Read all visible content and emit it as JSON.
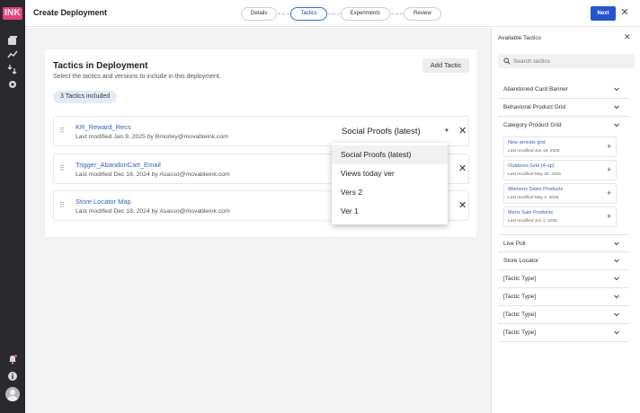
{
  "app": {
    "logo_text": "INK",
    "brand_color": "#e8407a",
    "accent_color": "#2454d6",
    "rail_icons": [
      "library-icon",
      "analytics-icon",
      "flows-icon",
      "settings-icon",
      "notification-bell-icon",
      "info-icon"
    ]
  },
  "header": {
    "title": "Create Deployment",
    "steps": [
      "Details",
      "Tactics",
      "Experiments",
      "Review"
    ],
    "active_step": "Tactics",
    "next_label": "Next",
    "close_label": "✕"
  },
  "main": {
    "card_title": "Tactics in Deployment",
    "card_subtitle": "Select the tactics and versions to include in this deployment.",
    "add_button": "Add Tactic",
    "count_badge": "3 Tactics included",
    "rows": [
      {
        "name": "KR_Reward_Recs",
        "meta": "Last modified Jan 9, 2025 by Bmorley@movableink.com",
        "version": "Social Proofs (latest)"
      },
      {
        "name": "Trigger_AbandonCart_Email",
        "meta": "Last modified Dec 18, 2024 by Asasso@movableink.com"
      },
      {
        "name": "Store Locator Map",
        "meta": "Last modified Dec 18, 2024 by Asasso@movableink.com"
      }
    ],
    "version_options": [
      "Social Proofs (latest)",
      "Views today ver",
      "Vers 2",
      "Ver 1"
    ]
  },
  "panel": {
    "title": "Available Tactics",
    "search_placeholder": "Search tactics",
    "categories": [
      {
        "label": "Abandoned Card Banner"
      },
      {
        "label": "Behavioral Product Grid"
      },
      {
        "label": "Category Product Grid",
        "expanded": true
      }
    ],
    "sub_items": [
      {
        "name": "New arrivals grid",
        "meta": "Last modified Jun 18, 2025"
      },
      {
        "name": "Outdoors Grid (4-up)",
        "meta": "Last modified May 20, 2025"
      },
      {
        "name": "Womens Sales Products",
        "meta": "Last modified May 2, 2025"
      },
      {
        "name": "Mens Sale Products",
        "meta": "Last modified Jun 1, 2025"
      }
    ],
    "more_categories": [
      "Live Poll",
      "Store Locator",
      "[Tactic Type]",
      "[Tactic Type]",
      "[Tactic Type]",
      "[Tactic Type]"
    ]
  }
}
